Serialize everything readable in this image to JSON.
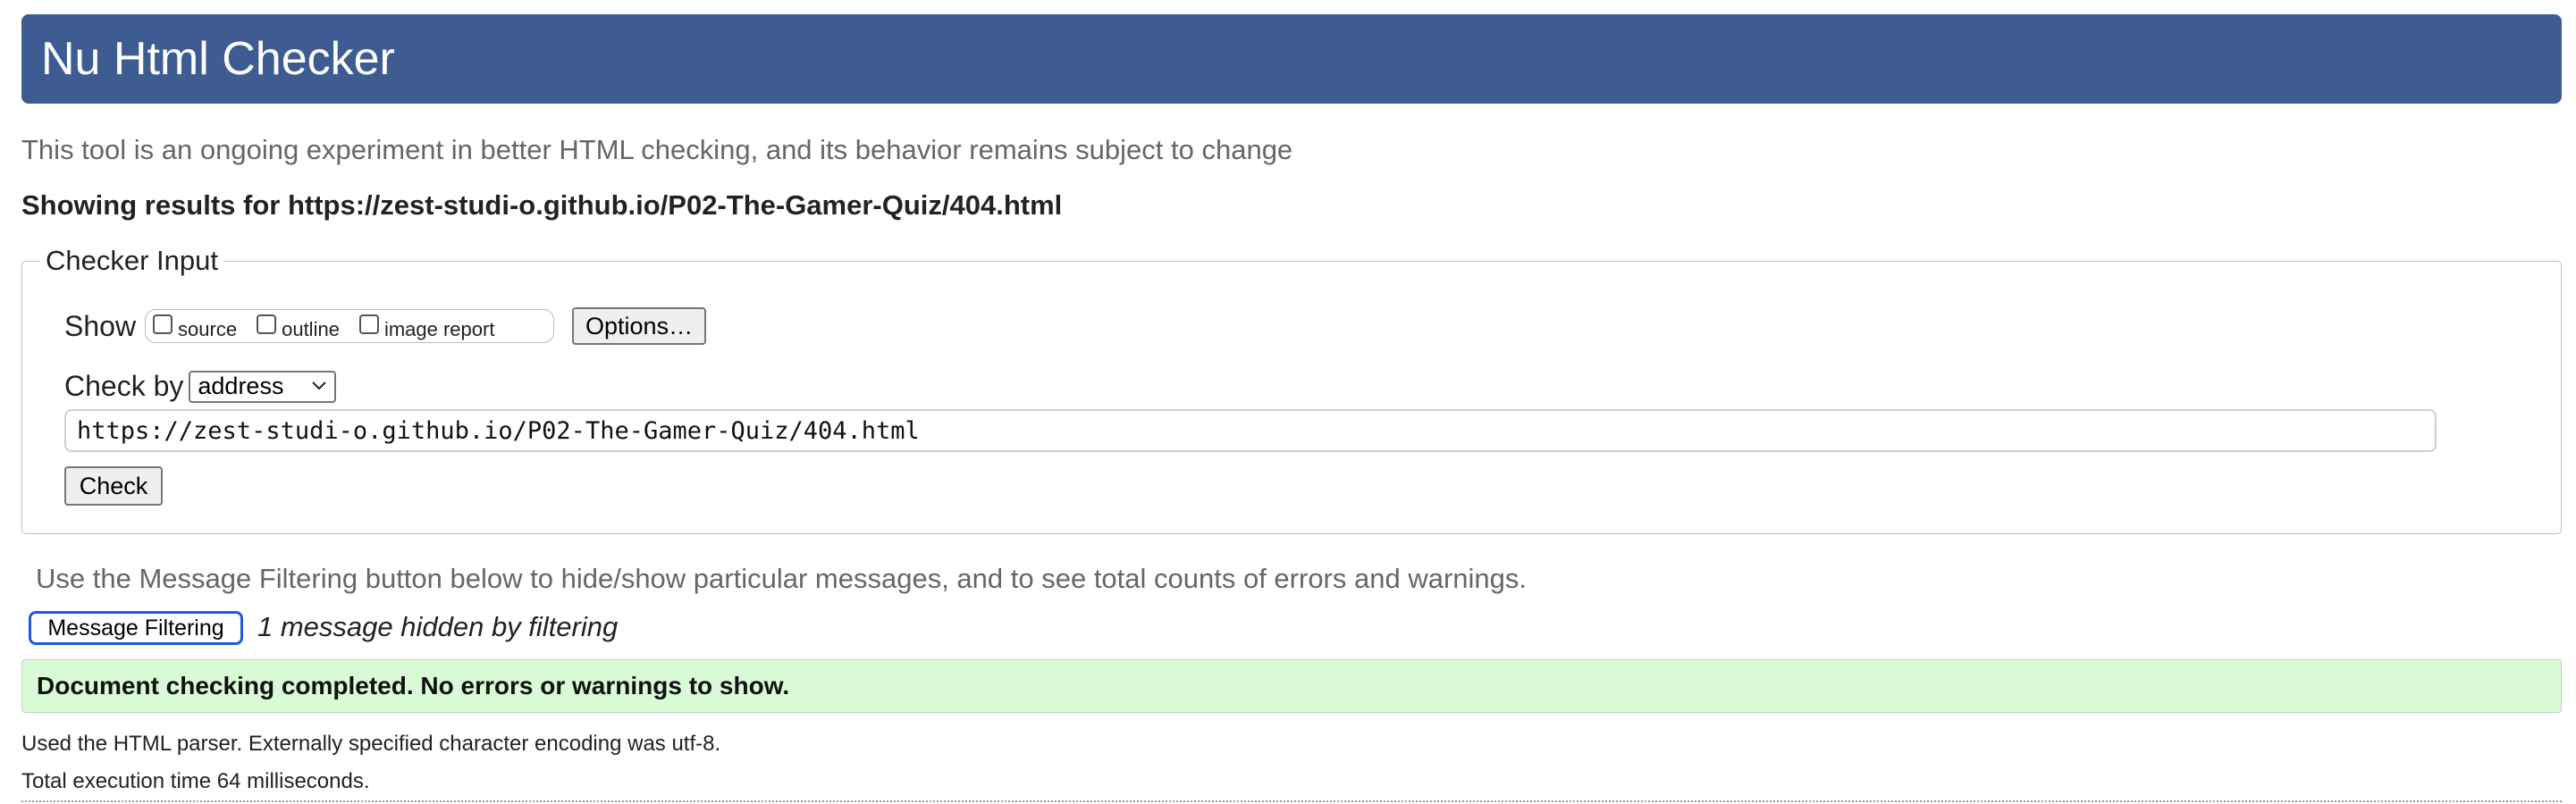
{
  "header": {
    "title": "Nu Html Checker"
  },
  "intro": "This tool is an ongoing experiment in better HTML checking, and its behavior remains subject to change",
  "results": {
    "prefix": "Showing results for ",
    "url": "https://zest-studi-o.github.io/P02-The-Gamer-Quiz/404.html"
  },
  "checker_input": {
    "legend": "Checker Input",
    "show_label": "Show",
    "show_options": [
      {
        "label": "source",
        "checked": false
      },
      {
        "label": "outline",
        "checked": false
      },
      {
        "label": "image report",
        "checked": false
      }
    ],
    "options_button": "Options…",
    "check_by_label": "Check by",
    "check_by_value": "address",
    "url_value": "https://zest-studi-o.github.io/P02-The-Gamer-Quiz/404.html",
    "check_button": "Check"
  },
  "filtering": {
    "note": "Use the Message Filtering button below to hide/show particular messages, and to see total counts of errors and warnings.",
    "button": "Message Filtering",
    "hidden_count_text": "1 message hidden by filtering"
  },
  "status": {
    "message": "Document checking completed. No errors or warnings to show."
  },
  "details": {
    "parser": "Used the HTML parser. Externally specified character encoding was utf-8.",
    "execution": "Total execution time 64 milliseconds."
  },
  "colors": {
    "header_bg": "#3e5c91",
    "success_bg": "#d8fad5",
    "focus_ring": "#1d5bd8"
  }
}
